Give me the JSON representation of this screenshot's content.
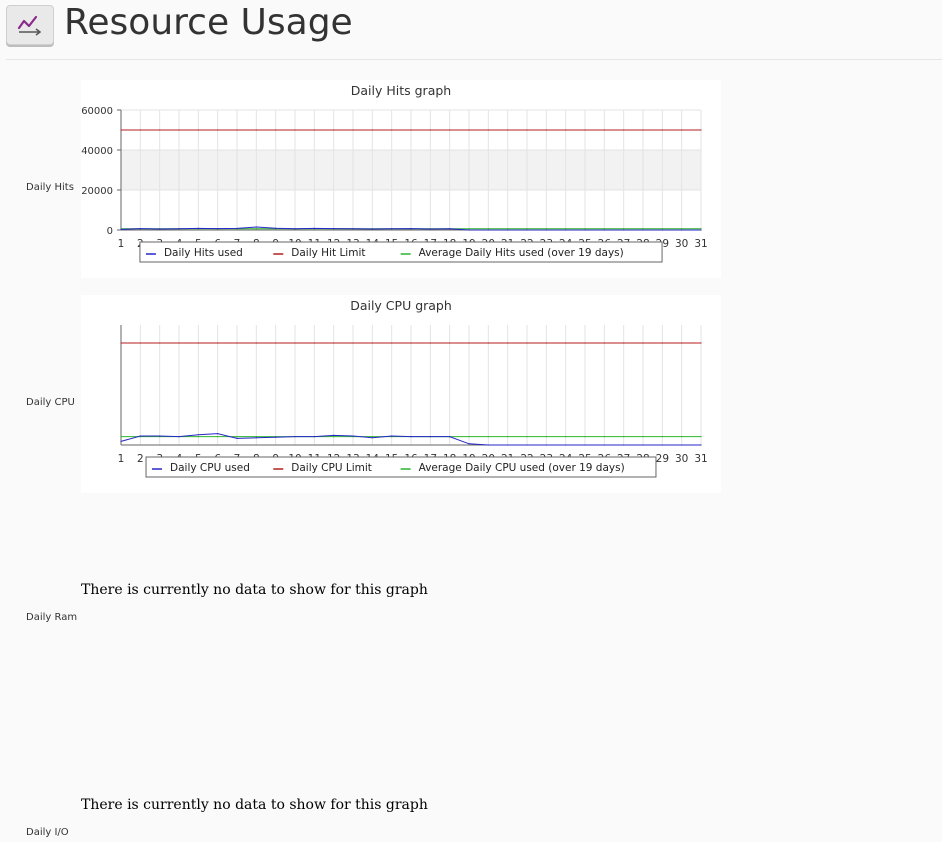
{
  "header": {
    "title": "Resource Usage",
    "icon": "chart-line-icon"
  },
  "rows": [
    {
      "label": "Daily Hits"
    },
    {
      "label": "Daily CPU"
    },
    {
      "label": "Daily Ram"
    },
    {
      "label": "Daily I/O"
    }
  ],
  "empty_message": "There is currently no data to show for this graph",
  "chart_data": [
    {
      "type": "line",
      "title": "Daily Hits graph",
      "x": [
        1,
        2,
        3,
        4,
        5,
        6,
        7,
        8,
        9,
        10,
        11,
        12,
        13,
        14,
        15,
        16,
        17,
        18,
        19,
        20,
        21,
        22,
        23,
        24,
        25,
        26,
        27,
        28,
        29,
        30,
        31
      ],
      "ylim": [
        0,
        60000
      ],
      "yticks": [
        0,
        20000,
        40000,
        60000
      ],
      "ytick_labels": [
        "0",
        "20000",
        "40000",
        "60000"
      ],
      "grid": true,
      "legend_position": "bottom",
      "series": [
        {
          "name": "Daily Hits used",
          "color": "#2727c8",
          "values": [
            300,
            700,
            500,
            600,
            800,
            700,
            800,
            1500,
            900,
            600,
            800,
            700,
            600,
            500,
            600,
            700,
            500,
            600,
            0,
            0,
            0,
            0,
            0,
            0,
            0,
            0,
            0,
            0,
            0,
            0,
            0
          ]
        },
        {
          "name": "Daily Hit Limit",
          "color": "#b41e1e",
          "values": [
            50000,
            50000,
            50000,
            50000,
            50000,
            50000,
            50000,
            50000,
            50000,
            50000,
            50000,
            50000,
            50000,
            50000,
            50000,
            50000,
            50000,
            50000,
            50000,
            50000,
            50000,
            50000,
            50000,
            50000,
            50000,
            50000,
            50000,
            50000,
            50000,
            50000,
            50000
          ]
        },
        {
          "name": "Average Daily Hits used (over 19 days)",
          "color": "#2db42d",
          "values": [
            650,
            650,
            650,
            650,
            650,
            650,
            650,
            650,
            650,
            650,
            650,
            650,
            650,
            650,
            650,
            650,
            650,
            650,
            650,
            650,
            650,
            650,
            650,
            650,
            650,
            650,
            650,
            650,
            650,
            650,
            650
          ]
        }
      ]
    },
    {
      "type": "line",
      "title": "Daily CPU graph",
      "x": [
        1,
        2,
        3,
        4,
        5,
        6,
        7,
        8,
        9,
        10,
        11,
        12,
        13,
        14,
        15,
        16,
        17,
        18,
        19,
        20,
        21,
        22,
        23,
        24,
        25,
        26,
        27,
        28,
        29,
        30,
        31
      ],
      "ylim": [
        0,
        100
      ],
      "grid": true,
      "legend_position": "bottom",
      "series": [
        {
          "name": "Daily CPU used",
          "color": "#2727c8",
          "values": [
            3,
            7.5,
            7.5,
            7,
            8.5,
            9.5,
            5.5,
            6,
            6.5,
            7,
            7,
            8,
            7.5,
            6,
            7.5,
            7,
            7,
            7,
            1,
            0,
            0,
            0,
            0,
            0,
            0,
            0,
            0,
            0,
            0,
            0,
            0
          ]
        },
        {
          "name": "Daily CPU Limit",
          "color": "#b41e1e",
          "values": [
            85,
            85,
            85,
            85,
            85,
            85,
            85,
            85,
            85,
            85,
            85,
            85,
            85,
            85,
            85,
            85,
            85,
            85,
            85,
            85,
            85,
            85,
            85,
            85,
            85,
            85,
            85,
            85,
            85,
            85,
            85
          ]
        },
        {
          "name": "Average Daily CPU used (over 19 days)",
          "color": "#2db42d",
          "values": [
            7,
            7,
            7,
            7,
            7,
            7,
            7,
            7,
            7,
            7,
            7,
            7,
            7,
            7,
            7,
            7,
            7,
            7,
            7,
            7,
            7,
            7,
            7,
            7,
            7,
            7,
            7,
            7,
            7,
            7,
            7
          ]
        }
      ]
    }
  ]
}
